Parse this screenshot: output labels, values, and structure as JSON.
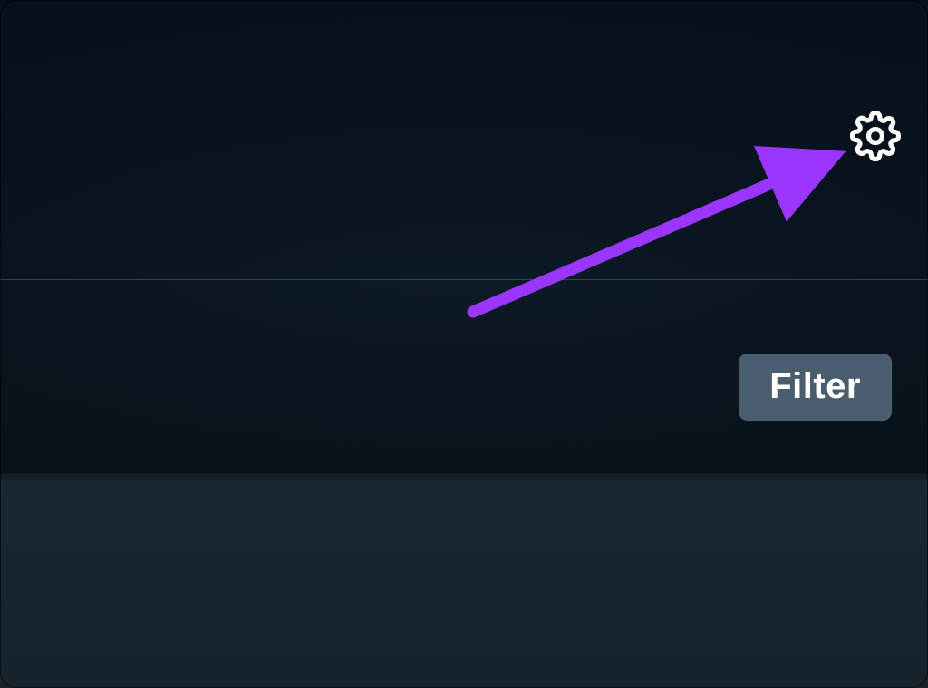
{
  "toolbar": {
    "settings_icon": "gear-icon"
  },
  "controls": {
    "filter_label": "Filter"
  },
  "annotation": {
    "arrow_color": "#9b36ff"
  }
}
